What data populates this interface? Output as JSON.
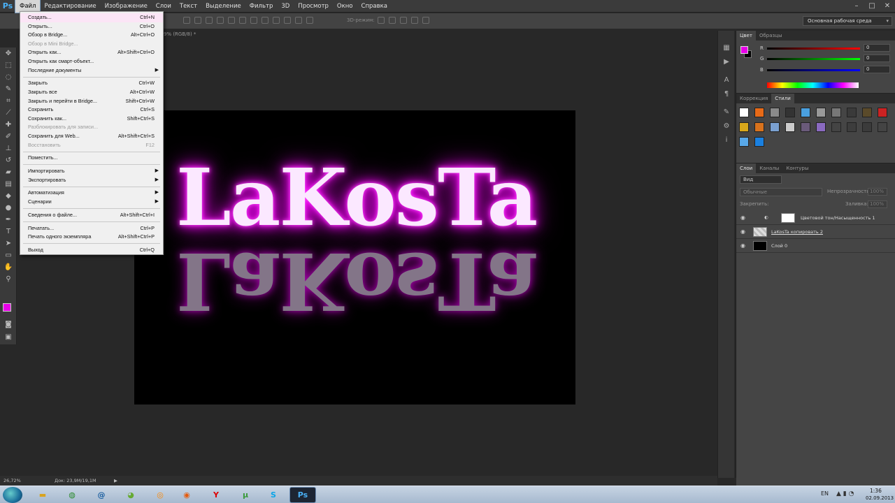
{
  "app": {
    "logo": "Ps"
  },
  "menubar": [
    "Файл",
    "Редактирование",
    "Изображение",
    "Слои",
    "Текст",
    "Выделение",
    "Фильтр",
    "3D",
    "Просмотр",
    "Окно",
    "Справка"
  ],
  "options": {
    "mode_label": "3D-режим:",
    "workspace": "Основная рабочая среда"
  },
  "document": {
    "tab": "9% (RGB/8) *",
    "title_text": "LaKosTa"
  },
  "file_menu": [
    {
      "label": "Создать...",
      "shortcut": "Ctrl+N"
    },
    {
      "label": "Открыть...",
      "shortcut": "Ctrl+O"
    },
    {
      "label": "Обзор в Bridge...",
      "shortcut": "Alt+Ctrl+O"
    },
    {
      "label": "Обзор в Mini Bridge...",
      "shortcut": "",
      "disabled": true
    },
    {
      "label": "Открыть как...",
      "shortcut": "Alt+Shift+Ctrl+O"
    },
    {
      "label": "Открыть как смарт-объект...",
      "shortcut": ""
    },
    {
      "label": "Последние документы",
      "shortcut": "",
      "submenu": true
    },
    {
      "sep": true
    },
    {
      "label": "Закрыть",
      "shortcut": "Ctrl+W"
    },
    {
      "label": "Закрыть все",
      "shortcut": "Alt+Ctrl+W"
    },
    {
      "label": "Закрыть и перейти в Bridge...",
      "shortcut": "Shift+Ctrl+W"
    },
    {
      "label": "Сохранить",
      "shortcut": "Ctrl+S"
    },
    {
      "label": "Сохранить как...",
      "shortcut": "Shift+Ctrl+S"
    },
    {
      "label": "Разблокировать для записи...",
      "shortcut": "",
      "disabled": true
    },
    {
      "label": "Сохранить для Web...",
      "shortcut": "Alt+Shift+Ctrl+S"
    },
    {
      "label": "Восстановить",
      "shortcut": "F12",
      "disabled": true
    },
    {
      "sep": true
    },
    {
      "label": "Поместить...",
      "shortcut": ""
    },
    {
      "sep": true
    },
    {
      "label": "Импортировать",
      "shortcut": "",
      "submenu": true
    },
    {
      "label": "Экспортировать",
      "shortcut": "",
      "submenu": true
    },
    {
      "sep": true
    },
    {
      "label": "Автоматизация",
      "shortcut": "",
      "submenu": true
    },
    {
      "label": "Сценарии",
      "shortcut": "",
      "submenu": true
    },
    {
      "sep": true
    },
    {
      "label": "Сведения о файле...",
      "shortcut": "Alt+Shift+Ctrl+I"
    },
    {
      "sep": true
    },
    {
      "label": "Печатать...",
      "shortcut": "Ctrl+P"
    },
    {
      "label": "Печать одного экземпляра",
      "shortcut": "Alt+Shift+Ctrl+P"
    },
    {
      "sep": true
    },
    {
      "label": "Выход",
      "shortcut": "Ctrl+Q"
    }
  ],
  "color_panel": {
    "tabs": [
      "Цвет",
      "Образцы"
    ],
    "foreground": "#e800e8",
    "background": "#000000",
    "channels": [
      {
        "label": "R",
        "value": "0"
      },
      {
        "label": "G",
        "value": "0"
      },
      {
        "label": "B",
        "value": "0"
      }
    ]
  },
  "styles_panel": {
    "tabs": [
      "Коррекция",
      "Стили"
    ]
  },
  "layers_panel": {
    "tabs": [
      "Слои",
      "Каналы",
      "Контуры"
    ],
    "kind": "Вид",
    "blend": "Обычные",
    "opacity_label": "Непрозрачность:",
    "opacity_value": "100%",
    "lock_label": "Закрепить:",
    "fill_label": "Заливка:",
    "fill_value": "100%",
    "layers": [
      {
        "name": "Цветовой тон/Насыщенность 1"
      },
      {
        "name": "LaKosTa копировать 2"
      },
      {
        "name": "Слой 0"
      }
    ]
  },
  "status": {
    "zoom": "26,72%",
    "doc": "Док: 23,9M/19,1M"
  },
  "taskbar": {
    "lang": "EN",
    "time": "1:36",
    "date": "02.09.2013"
  }
}
